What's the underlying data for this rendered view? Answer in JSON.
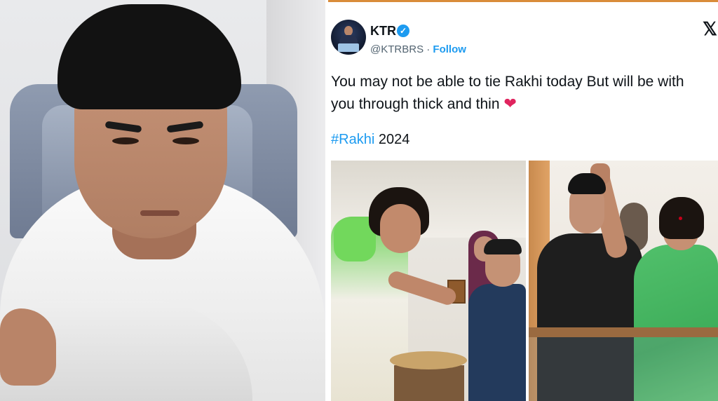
{
  "tweet": {
    "display_name": "KTR",
    "verified_glyph": "✓",
    "handle": "@KTRBRS",
    "separator": "·",
    "follow_label": "Follow",
    "x_logo": "𝕏",
    "text": "You may not be able to tie Rakhi today But will be with you through thick and thin",
    "heart": "❤",
    "hashtag": "#Rakhi",
    "hashtag_suffix": " 2024"
  },
  "colors": {
    "link_blue": "#1d9bf0",
    "heart_red": "#e0245e",
    "text": "#0f1419",
    "muted": "#536471"
  },
  "icons": {
    "verified": "verified-badge-icon",
    "x_logo": "x-logo-icon",
    "heart": "heart-icon"
  }
}
